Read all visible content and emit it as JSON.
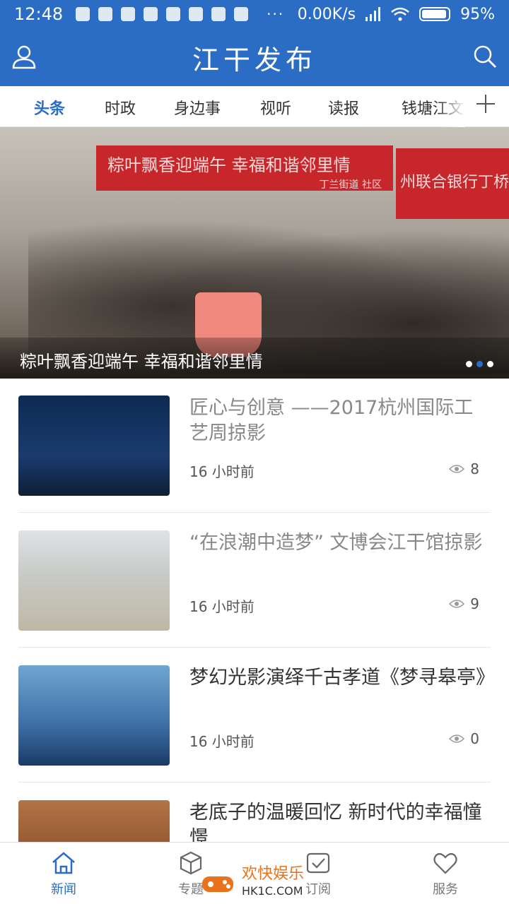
{
  "status_bar": {
    "time": "12:48",
    "network_speed": "0.00K/s",
    "battery": "95%",
    "menu_dots": "···"
  },
  "header": {
    "title": "江干发布",
    "left_icon": "user-icon",
    "right_icon": "search-icon"
  },
  "tabs": [
    {
      "label": "头条",
      "active": true
    },
    {
      "label": "时政",
      "active": false
    },
    {
      "label": "身边事",
      "active": false
    },
    {
      "label": "视听",
      "active": false
    },
    {
      "label": "读报",
      "active": false
    },
    {
      "label": "钱塘江文",
      "active": false
    }
  ],
  "banner": {
    "caption": "粽叶飘香迎端午 幸福和谐邻里情",
    "photo_banner_text": "粽叶飘香迎端午 幸福和谐邻里情",
    "photo_banner_sub": "丁兰街道  社区",
    "photo_banner2_text": "州联合银行丁桥",
    "page_count": 3,
    "current_page": 2
  },
  "news": [
    {
      "title": "匠心与创意 ——2017杭州国际工艺周掠影",
      "time": "16 小时前",
      "views": "8",
      "read": true
    },
    {
      "title": "“在浪潮中造梦” 文博会江干馆掠影",
      "time": "16 小时前",
      "views": "9",
      "read": true
    },
    {
      "title": "梦幻光影演绎千古孝道《梦寻皋亭》",
      "time": "16 小时前",
      "views": "0",
      "read": false
    },
    {
      "title": "老底子的温暖回忆 新时代的幸福憧憬",
      "time": "",
      "views": "",
      "read": false
    }
  ],
  "bottom_nav": [
    {
      "label": "新闻",
      "icon": "home-icon",
      "active": true
    },
    {
      "label": "专题",
      "icon": "cube-icon",
      "active": false
    },
    {
      "label": "订阅",
      "icon": "check-square-icon",
      "active": false
    },
    {
      "label": "服务",
      "icon": "heart-icon",
      "active": false
    }
  ],
  "watermark": {
    "line1": "欢快娱乐",
    "line2": "HK1C.COM"
  },
  "colors": {
    "brand": "#2b6cc4",
    "read_title": "#888888",
    "text": "#333333"
  }
}
